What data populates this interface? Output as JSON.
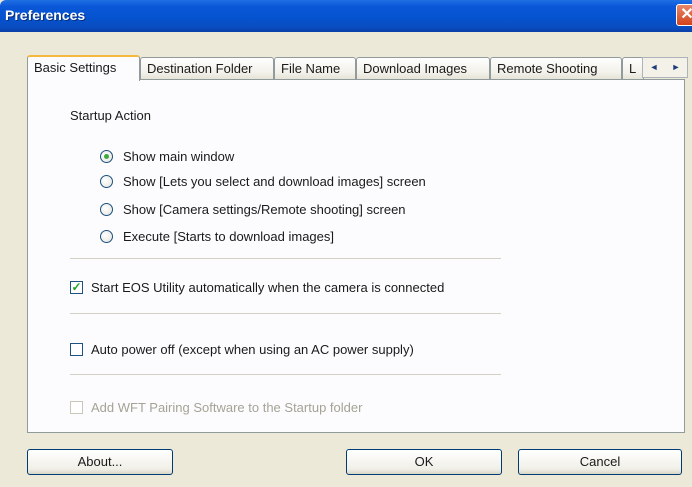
{
  "window": {
    "title": "Preferences",
    "close_glyph": "✕"
  },
  "tabs": [
    {
      "label": "Basic Settings",
      "active": true
    },
    {
      "label": "Destination Folder",
      "active": false
    },
    {
      "label": "File Name",
      "active": false
    },
    {
      "label": "Download Images",
      "active": false
    },
    {
      "label": "Remote Shooting",
      "active": false
    },
    {
      "label": "L",
      "active": false
    }
  ],
  "tab_scroll": {
    "left_glyph": "◄",
    "right_glyph": "►"
  },
  "startup_action": {
    "label": "Startup Action",
    "options": [
      {
        "label": "Show main window",
        "selected": true
      },
      {
        "label": "Show [Lets you select and download images] screen",
        "selected": false
      },
      {
        "label": "Show [Camera settings/Remote shooting] screen",
        "selected": false
      },
      {
        "label": "Execute [Starts to download images]",
        "selected": false
      }
    ]
  },
  "checkboxes": {
    "start_eos": {
      "label": "Start EOS Utility automatically when the camera is connected",
      "checked": true,
      "check_glyph": "✓"
    },
    "auto_power_off": {
      "label": "Auto power off (except when using an AC power supply)",
      "checked": false
    },
    "wft_pairing": {
      "label": "Add WFT Pairing Software to the Startup folder",
      "checked": false,
      "enabled": false
    }
  },
  "buttons": {
    "about": "About...",
    "ok": "OK",
    "cancel": "Cancel"
  },
  "colors": {
    "titlebar": "#0553cf",
    "active_tab_accent": "#f5b941",
    "close_button": "#d2431b",
    "radio_dot": "#3eaa3e"
  }
}
